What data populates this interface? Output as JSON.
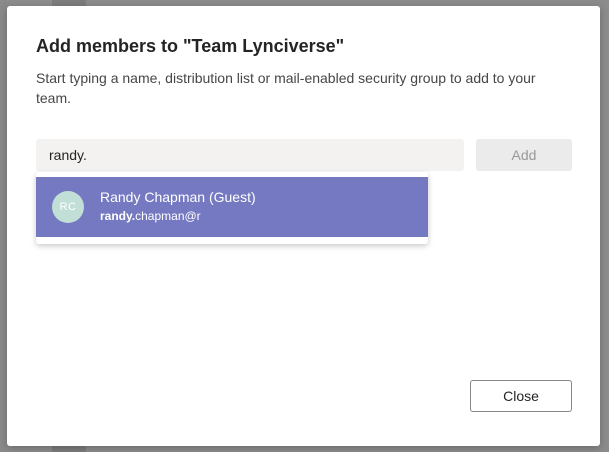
{
  "dialog": {
    "title": "Add members to \"Team Lynciverse\"",
    "description": "Start typing a name, distribution list or mail-enabled security group to add to your team.",
    "search": {
      "value": "randy."
    },
    "add_label": "Add",
    "close_label": "Close"
  },
  "suggestions": [
    {
      "initials": "RC",
      "name": "Randy Chapman (Guest)",
      "email_match": "randy.",
      "email_rest": "chapman@r"
    }
  ],
  "colors": {
    "selected_suggestion": "#7479c1",
    "avatar": "#c1dfd7",
    "search_background": "#f3f2f1",
    "overlay": "#8c8c8c"
  }
}
